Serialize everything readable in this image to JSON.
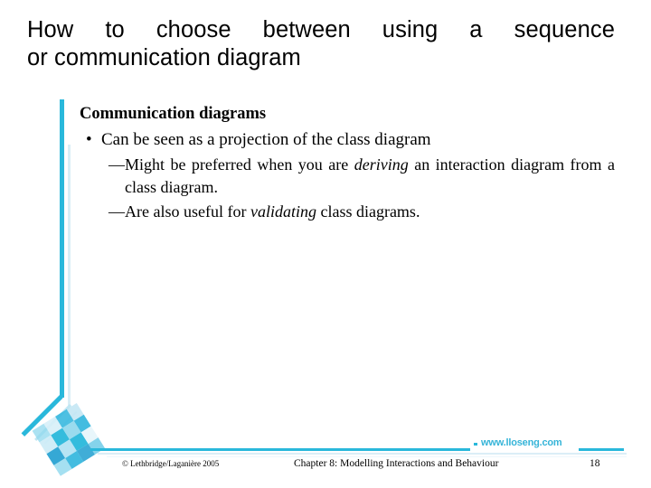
{
  "slide": {
    "title_line1": "How to choose between using a sequence",
    "title_line2": "or communication diagram",
    "heading": "Communication diagrams",
    "bullet_marker": "•",
    "bullet1": "Can be seen as a projection of the class diagram",
    "sub1_prefix": "—Might be preferred when you are ",
    "sub1_italic": "deriving",
    "sub1_suffix": " an interaction diagram from a class diagram.",
    "sub2_prefix": "—Are also useful for ",
    "sub2_italic": "validating",
    "sub2_suffix": " class diagrams."
  },
  "footer": {
    "copyright": "© Lethbridge/Laganière 2005",
    "chapter": "Chapter 8: Modelling Interactions and Behaviour",
    "page_number": "18",
    "site_url": "www.lloseng.com"
  },
  "colors": {
    "accent": "#29b8db",
    "accent_light": "#6fd0e8",
    "accent_pale": "#bfe6f3",
    "accent_faint": "#e3f3fa",
    "text": "#000000",
    "background": "#ffffff"
  }
}
